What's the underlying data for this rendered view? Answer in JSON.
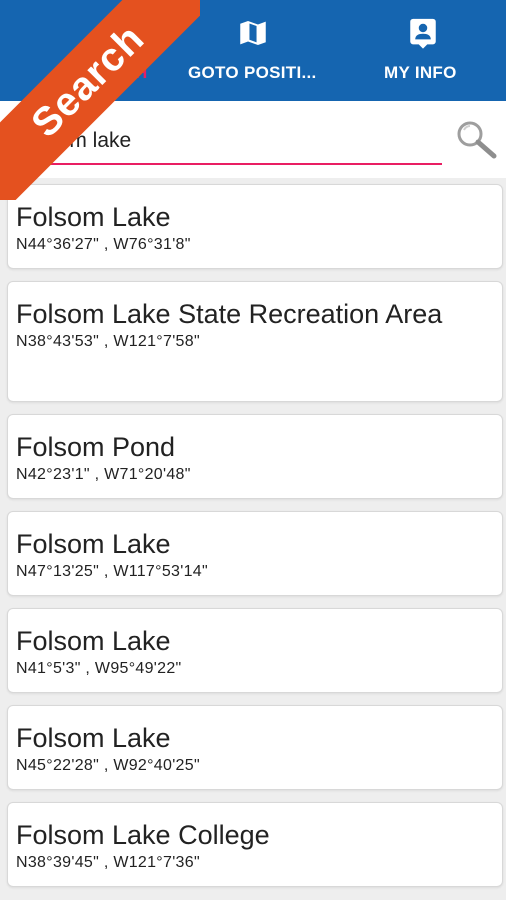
{
  "tabs": [
    {
      "label": "SEARCH",
      "icon": "search-icon"
    },
    {
      "label": "GOTO POSITI...",
      "icon": "map-icon"
    },
    {
      "label": "MY INFO",
      "icon": "contact-card-icon"
    }
  ],
  "ribbon": {
    "label": "Search"
  },
  "search": {
    "value": "Folsom lake"
  },
  "results": [
    {
      "name": "Folsom Lake",
      "coords": "N44°36'27\" , W76°31'8\""
    },
    {
      "name": "Folsom Lake State Recreation Area",
      "coords": "N38°43'53\" , W121°7'58\""
    },
    {
      "name": "Folsom Pond",
      "coords": "N42°23'1\" , W71°20'48\""
    },
    {
      "name": "Folsom Lake",
      "coords": "N47°13'25\" , W117°53'14\""
    },
    {
      "name": "Folsom Lake",
      "coords": "N41°5'3\" , W95°49'22\""
    },
    {
      "name": "Folsom Lake",
      "coords": "N45°22'28\" , W92°40'25\""
    },
    {
      "name": "Folsom Lake College",
      "coords": "N38°39'45\" , W121°7'36\""
    }
  ],
  "colors": {
    "topbar": "#1565b0",
    "accent": "#e91e63",
    "ribbon": "#e4511f"
  }
}
